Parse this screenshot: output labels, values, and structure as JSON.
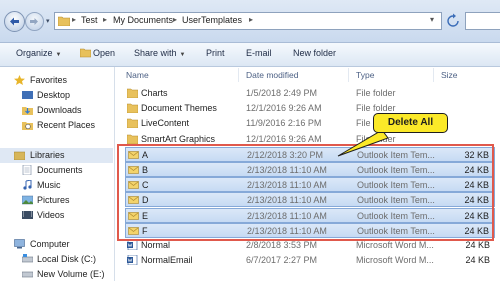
{
  "address_bar": {
    "breadcrumbs": [
      "Test",
      "My Documents",
      "UserTemplates"
    ]
  },
  "toolbar": {
    "organize": "Organize",
    "open": "Open",
    "share_with": "Share with",
    "print": "Print",
    "email": "E-mail",
    "new_folder": "New folder"
  },
  "nav": {
    "favorites": "Favorites",
    "desktop": "Desktop",
    "downloads": "Downloads",
    "recent_places": "Recent Places",
    "libraries": "Libraries",
    "documents": "Documents",
    "music": "Music",
    "pictures": "Pictures",
    "videos": "Videos",
    "computer": "Computer",
    "local_disk": "Local Disk (C:)",
    "new_volume": "New Volume (E:)"
  },
  "columns": {
    "name": "Name",
    "date_modified": "Date modified",
    "type": "Type",
    "size": "Size"
  },
  "files": [
    {
      "name": "Charts",
      "date": "1/5/2018 2:49 PM",
      "type": "File folder",
      "size": "",
      "kind": "folder"
    },
    {
      "name": "Document Themes",
      "date": "12/1/2016 9:26 AM",
      "type": "File folder",
      "size": "",
      "kind": "folder"
    },
    {
      "name": "LiveContent",
      "date": "11/9/2016 2:16 PM",
      "type": "File folder",
      "size": "",
      "kind": "folder"
    },
    {
      "name": "SmartArt Graphics",
      "date": "12/1/2016 9:26 AM",
      "type": "File folder",
      "size": "",
      "kind": "folder"
    },
    {
      "name": "A",
      "date": "2/12/2018 3:20 PM",
      "type": "Outlook Item Tem...",
      "size": "32 KB",
      "kind": "mail"
    },
    {
      "name": "B",
      "date": "2/13/2018 11:10 AM",
      "type": "Outlook Item Tem...",
      "size": "24 KB",
      "kind": "mail"
    },
    {
      "name": "C",
      "date": "2/13/2018 11:10 AM",
      "type": "Outlook Item Tem...",
      "size": "24 KB",
      "kind": "mail"
    },
    {
      "name": "D",
      "date": "2/13/2018 11:10 AM",
      "type": "Outlook Item Tem...",
      "size": "24 KB",
      "kind": "mail"
    },
    {
      "name": "E",
      "date": "2/13/2018 11:10 AM",
      "type": "Outlook Item Tem...",
      "size": "24 KB",
      "kind": "mail"
    },
    {
      "name": "F",
      "date": "2/13/2018 11:10 AM",
      "type": "Outlook Item Tem...",
      "size": "24 KB",
      "kind": "mail"
    },
    {
      "name": "Normal",
      "date": "2/8/2018 3:53 PM",
      "type": "Microsoft Word M...",
      "size": "24 KB",
      "kind": "word"
    },
    {
      "name": "NormalEmail",
      "date": "6/7/2017 2:27 PM",
      "type": "Microsoft Word M...",
      "size": "24 KB",
      "kind": "word"
    }
  ],
  "callout": {
    "text": "Delete All"
  },
  "colors": {
    "highlight_border": "#e0594c",
    "callout_fill": "#fbe928",
    "selection_fill": "#c6daf3"
  }
}
